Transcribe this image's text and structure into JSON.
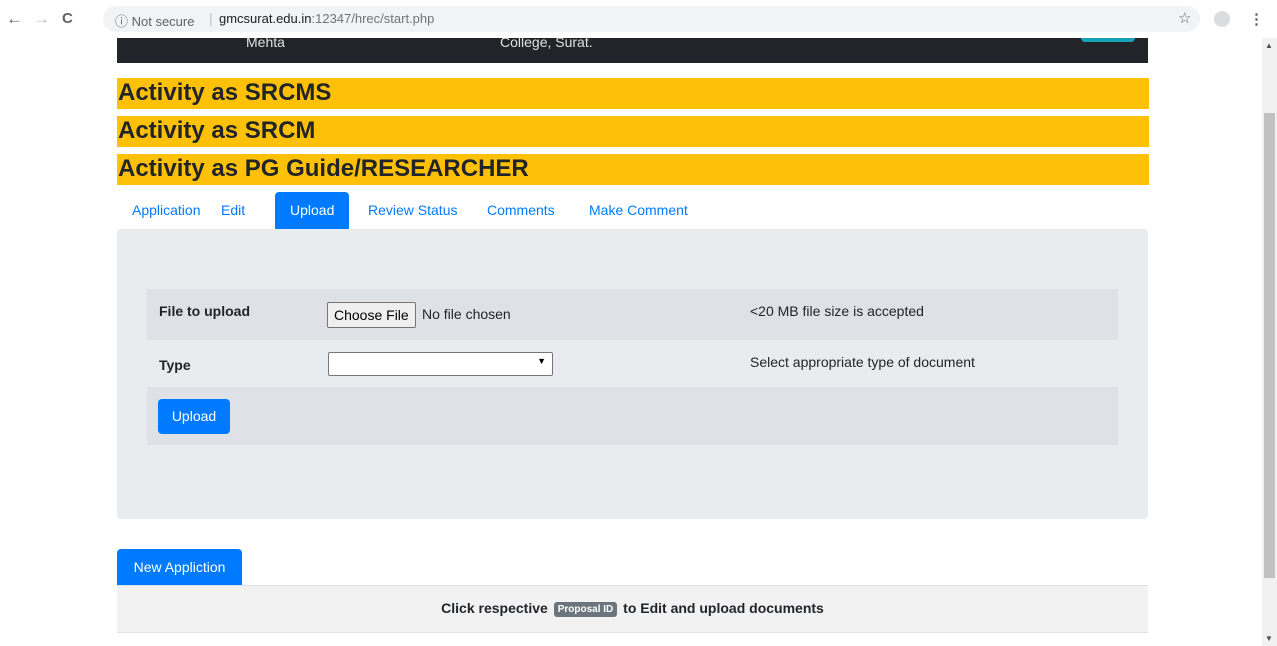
{
  "browser": {
    "back_icon": "←",
    "forward_icon": "→",
    "reload_icon": "C",
    "security_label": "ⓘ Not secure",
    "url_host": "gmcsurat.edu.in",
    "url_path": ":12347/hrec/start.php",
    "star_icon": "☆",
    "menu_icon": "⋮"
  },
  "header": {
    "left_text": "Mehta",
    "center_text": "College, Surat."
  },
  "activities": [
    "Activity as SRCMS",
    "Activity as SRCM",
    "Activity as PG Guide/RESEARCHER"
  ],
  "tabs": [
    {
      "label": "Application"
    },
    {
      "label": "Edit"
    },
    {
      "label": "Upload"
    },
    {
      "label": "Review Status"
    },
    {
      "label": "Comments"
    },
    {
      "label": "Make Comment"
    }
  ],
  "upload_form": {
    "file_label": "File to upload",
    "choose_button": "Choose File",
    "no_file_text": "No file chosen",
    "file_hint": "<20 MB file size is accepted",
    "type_label": "Type",
    "type_value": "",
    "type_hint": "Select appropriate type of document",
    "upload_button": "Upload"
  },
  "new_application_button": "New Appliction",
  "footer": {
    "prefix": "Click respective",
    "badge": "Proposal ID",
    "suffix": "to Edit and upload documents"
  },
  "colors": {
    "activity_bg": "#ffc107",
    "primary": "#007bff",
    "dark_header": "#212529"
  }
}
